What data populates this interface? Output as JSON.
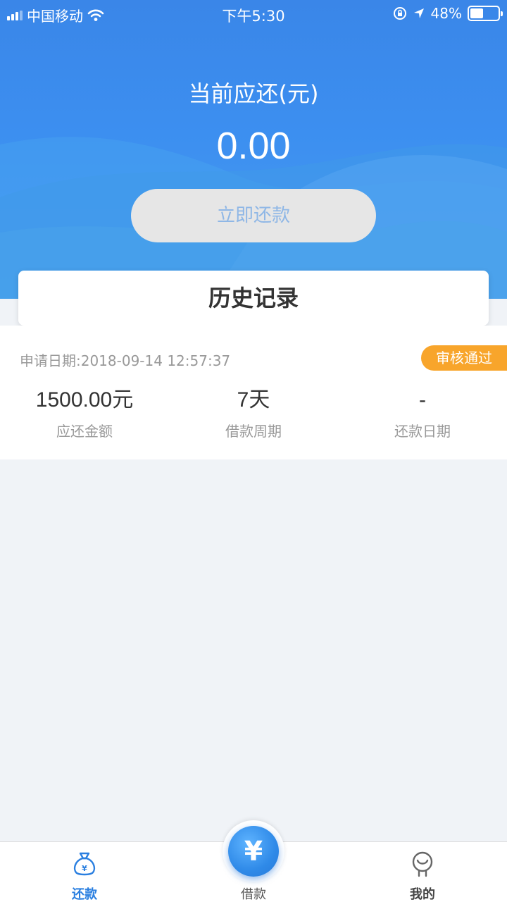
{
  "status_bar": {
    "carrier": "中国移动",
    "time": "下午5:30",
    "battery": "48%",
    "battery_level": 0.48
  },
  "hero": {
    "title": "当前应还(元)",
    "amount": "0.00",
    "repay_button": "立即还款"
  },
  "history": {
    "title": "历史记录",
    "records": [
      {
        "apply_date": "申请日期:2018-09-14 12:57:37",
        "status": "审核通过",
        "amount": "1500.00元",
        "amount_label": "应还金额",
        "period": "7天",
        "period_label": "借款周期",
        "repay_date": "-",
        "repay_date_label": "还款日期"
      }
    ]
  },
  "tabbar": {
    "tabs": [
      {
        "label": "还款",
        "icon": "money-bag-icon",
        "active": true
      },
      {
        "label": "借款",
        "icon": "yen-icon",
        "active": false
      },
      {
        "label": "我的",
        "icon": "user-icon",
        "active": false
      }
    ],
    "fab_symbol": "¥"
  },
  "colors": {
    "primary": "#3a86e8",
    "badge": "#f8a52b",
    "active_tab": "#2a7fe0"
  }
}
